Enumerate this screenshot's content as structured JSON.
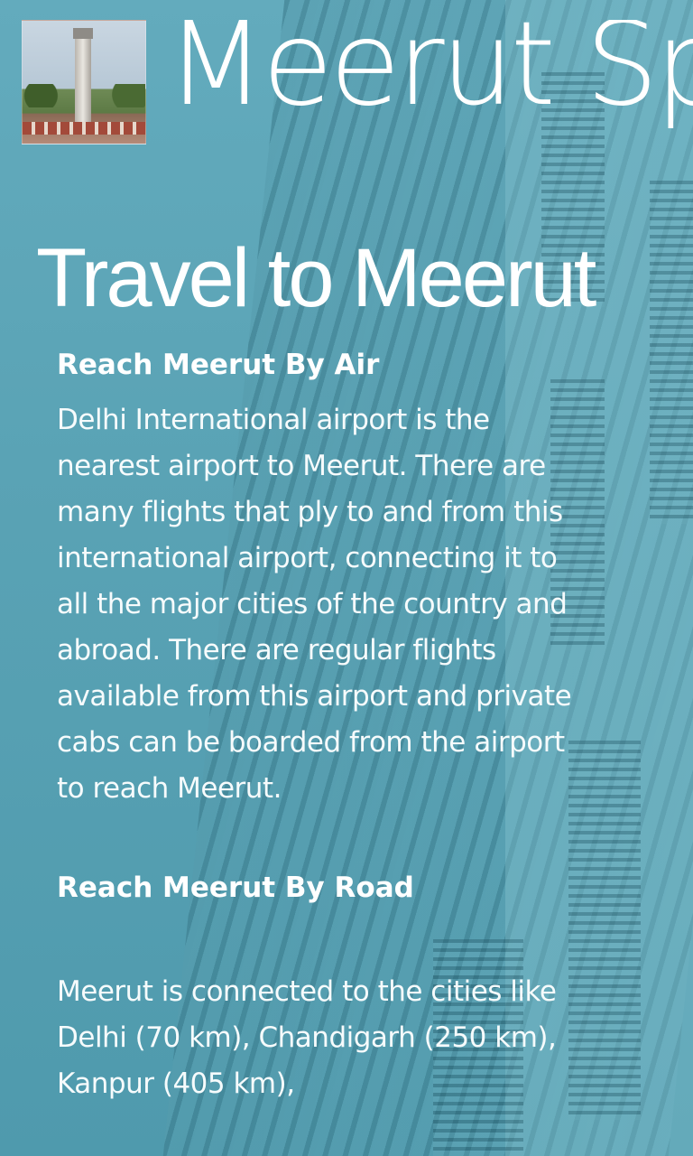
{
  "header": {
    "app_title": "Meerut Sp",
    "logo_alt": "Meerut landmark"
  },
  "page": {
    "title": "Travel to Meerut"
  },
  "sections": [
    {
      "heading": "Reach Meerut By Air",
      "body": "Delhi International airport is the nearest airport to Meerut. There are many flights that ply to and from this international airport, connecting it to all the major cities of the country and abroad. There are regular flights available from this airport and private cabs can be boarded from the airport to reach Meerut."
    },
    {
      "heading": "Reach Meerut By Road",
      "body": "Meerut is connected to the cities like Delhi (70 km), Chandigarh (250 km), Kanpur (405 km),"
    }
  ],
  "colors": {
    "background": "#5ea7b9",
    "text": "#ffffff"
  }
}
